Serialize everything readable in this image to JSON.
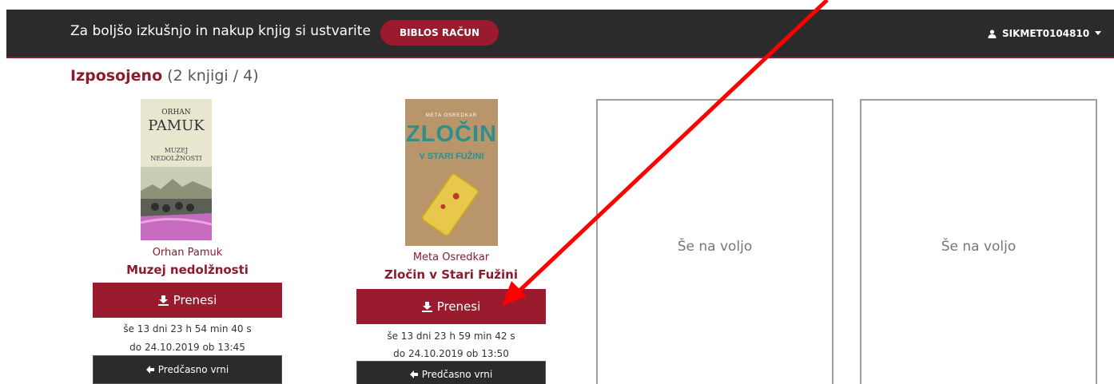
{
  "topbar": {
    "message": "Za boljšo izkušnjo in nakup knjig si ustvarite",
    "account_button": "BIBLOS RAČUN",
    "user": "SIKMET0104810",
    "user_icon": "user-icon",
    "caret_icon": "caret-down-icon"
  },
  "section": {
    "title": "Izposojeno",
    "count": "(2 knjigi / 4)"
  },
  "books": [
    {
      "cover_lines": [
        "ORHAN",
        "PAMUK",
        "MUZEJ",
        "NEDOLŽNOSTI"
      ],
      "author": "Orhan Pamuk",
      "title": "Muzej nedolžnosti",
      "download_label": "Prenesi",
      "time_left": "še 13 dni 23 h 54 min 40 s",
      "due_date": "do 24.10.2019 ob 13:45",
      "return_label": "Predčasno vrni"
    },
    {
      "cover_lines": [
        "META OSREDKAR",
        "ZLOČIN",
        "V STARI FUŽINI"
      ],
      "author": "Meta Osredkar",
      "title": "Zločin v Stari Fužini",
      "download_label": "Prenesi",
      "time_left": "še 13 dni 23 h 59 min 42 s",
      "due_date": "do 24.10.2019 ob 13:50",
      "return_label": "Predčasno vrni"
    }
  ],
  "slots": [
    {
      "label": "Še na voljo"
    },
    {
      "label": "Še na voljo"
    }
  ],
  "colors": {
    "brand": "#9a1a2e",
    "topbar": "#2b2b2b",
    "annotation_arrow": "#ff0000"
  }
}
